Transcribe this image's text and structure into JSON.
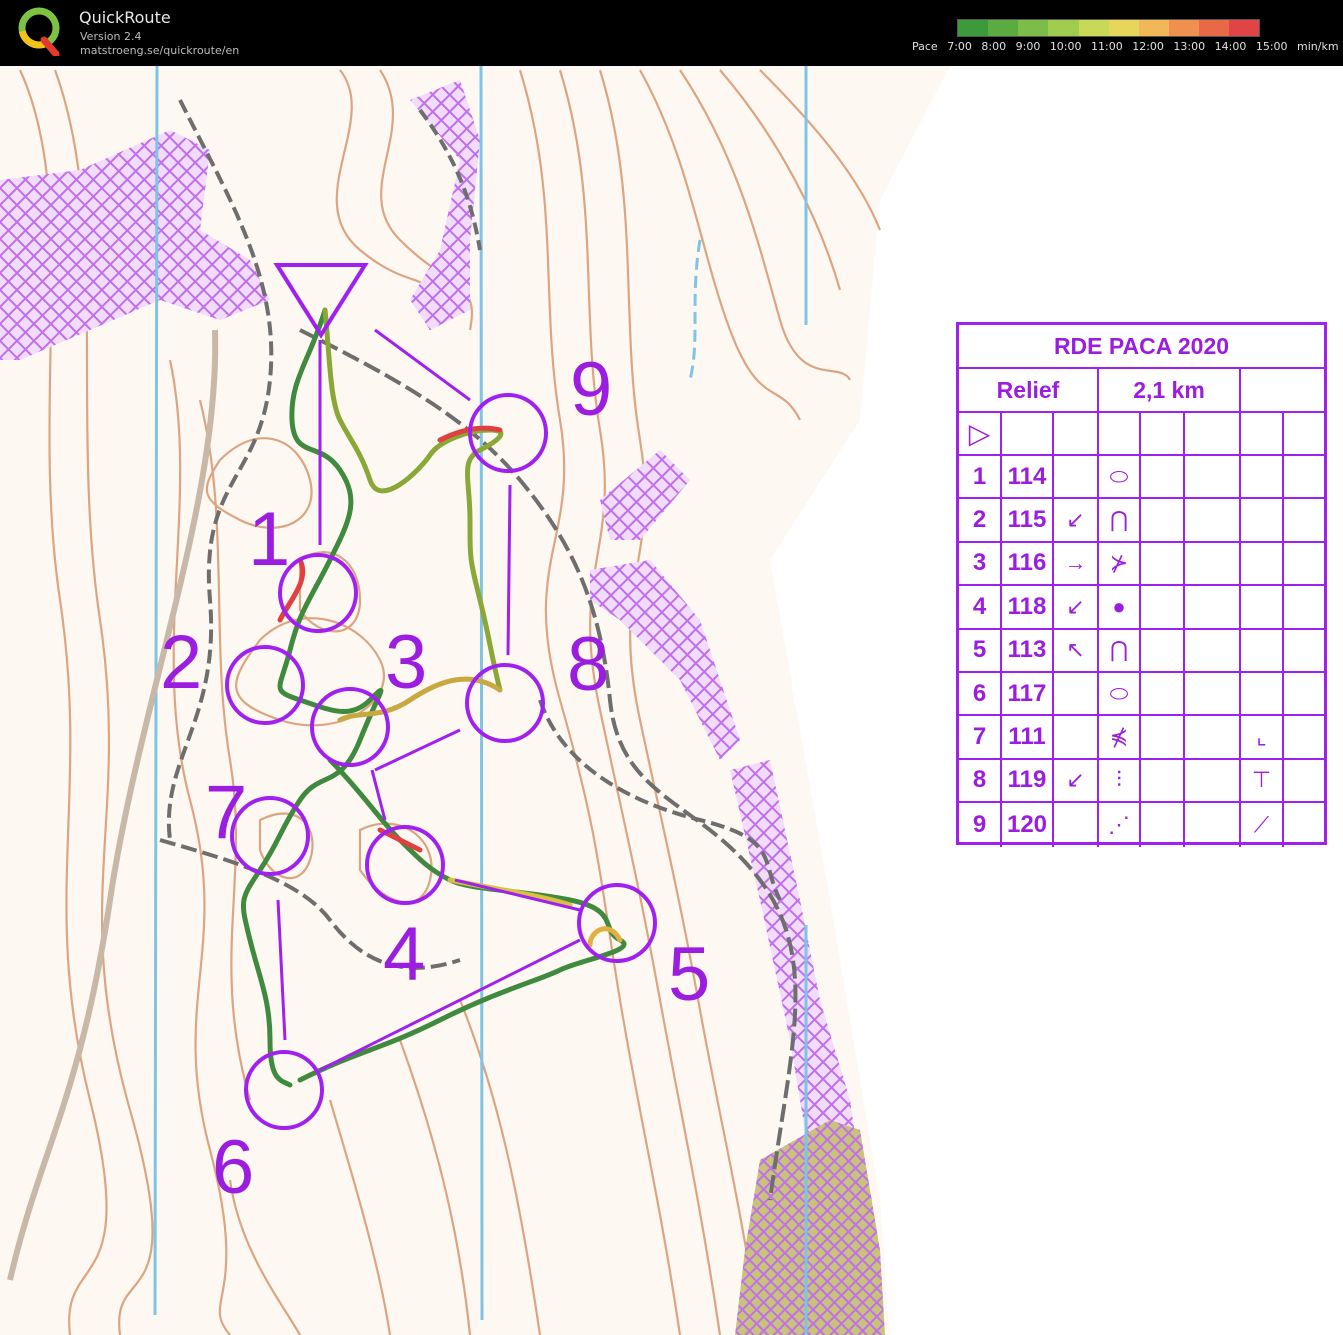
{
  "app": {
    "name": "QuickRoute",
    "version": "Version 2.4",
    "url": "matstroeng.se/quickroute/en"
  },
  "pace_legend": {
    "label": "Pace",
    "ticks": [
      "7:00",
      "8:00",
      "9:00",
      "10:00",
      "11:00",
      "12:00",
      "13:00",
      "14:00",
      "15:00"
    ],
    "unit": "min/km",
    "colors": [
      "#3c9a3c",
      "#5aab40",
      "#7cbc48",
      "#a0cc50",
      "#c8d858",
      "#e8d65c",
      "#f0b858",
      "#f09050",
      "#e86848",
      "#e04444"
    ]
  },
  "course": {
    "colors": {
      "course": "#a020f0",
      "route_fast": "#3f8a3f",
      "route_slow": "#e04040",
      "contour": "#d9a07c",
      "grid": "#7ec4e4",
      "path": "#707070",
      "hatch": "#cc88ee"
    },
    "control_labels": [
      "1",
      "2",
      "3",
      "4",
      "5",
      "6",
      "7",
      "8",
      "9"
    ]
  },
  "description": {
    "event": "RDE PACA 2020",
    "course_name": "Relief",
    "length": "2,1 km",
    "start_symbol": "▷",
    "rows": [
      {
        "num": "1",
        "code": "114",
        "dir": "",
        "feature": "⬭",
        "extra": ""
      },
      {
        "num": "2",
        "code": "115",
        "dir": "↙",
        "feature": "⋂",
        "extra": ""
      },
      {
        "num": "3",
        "code": "116",
        "dir": "→",
        "feature": "⊁",
        "extra": ""
      },
      {
        "num": "4",
        "code": "118",
        "dir": "↙",
        "feature": "●",
        "extra": ""
      },
      {
        "num": "5",
        "code": "113",
        "dir": "↖",
        "feature": "⋂",
        "extra": ""
      },
      {
        "num": "6",
        "code": "117",
        "dir": "",
        "feature": "⬭",
        "extra": ""
      },
      {
        "num": "7",
        "code": "111",
        "dir": "",
        "feature": "⋠",
        "extra": "⌞"
      },
      {
        "num": "8",
        "code": "119",
        "dir": "↙",
        "feature": "⫶",
        "extra": "⊤"
      },
      {
        "num": "9",
        "code": "120",
        "dir": "",
        "feature": "⋰",
        "extra": "⟋"
      }
    ]
  }
}
